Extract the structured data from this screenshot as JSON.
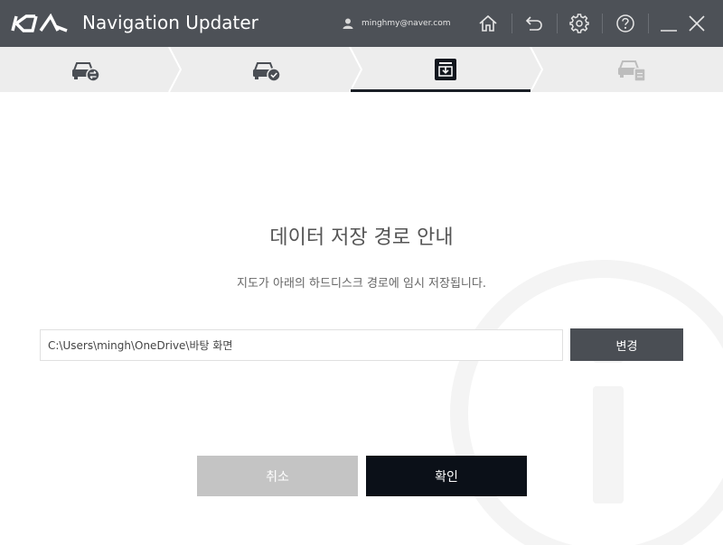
{
  "app": {
    "title": "Navigation Updater",
    "logo_text": "KIA",
    "user_email": "minghmy@naver.com"
  },
  "titlebar_icons": [
    "home-icon",
    "back-icon",
    "gear-icon",
    "help-icon",
    "minimize-icon",
    "close-icon"
  ],
  "steps": [
    {
      "icon": "car-transfer-icon",
      "state": "done"
    },
    {
      "icon": "car-check-icon",
      "state": "done"
    },
    {
      "icon": "download-box-icon",
      "state": "active"
    },
    {
      "icon": "car-update-icon",
      "state": "pending"
    }
  ],
  "main": {
    "heading": "데이터 저장 경로 안내",
    "description": "지도가 아래의 하드디스크 경로에 임시 저장됩니다.",
    "path_value": "C:\\Users\\mingh\\OneDrive\\바탕 화면",
    "change_label": "변경",
    "cancel_label": "취소",
    "confirm_label": "확인"
  },
  "colors": {
    "titlebar": "#4d5157",
    "steps_bg": "#ededed",
    "change_button": "#4a4e54",
    "cancel_button": "#c4c4c4",
    "confirm_button": "#0b1018"
  }
}
